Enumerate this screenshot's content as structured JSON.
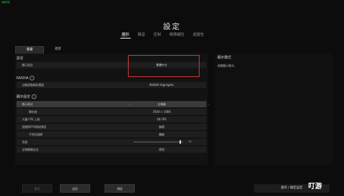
{
  "overlay": {
    "fps": "99FPS"
  },
  "title": "設定",
  "main_tabs": [
    "圖形",
    "聲音",
    "控制",
    "無障礙性",
    "遊戲性"
  ],
  "sub_tabs": [
    "基礎",
    "進階"
  ],
  "sections": {
    "language": "語言",
    "nvidia": "NVIDIA",
    "display": "顯示設定"
  },
  "rows": {
    "display_language": {
      "label": "顯示語言",
      "value": "繁體中文"
    },
    "nvidia_highlights": {
      "label": "自動錄製精彩畫面",
      "value": "NVIDIA Highlights"
    },
    "display_mode": {
      "label": "顯示模式",
      "value": "全螢幕"
    },
    "resolution": {
      "label": "解析度",
      "value": "1920 × 1080"
    },
    "max_fps": {
      "label": "大廳 FPS 上限",
      "value": "60 FPS"
    },
    "fps_limit": {
      "label": "遊戲時FPS限制預設",
      "value": "無限"
    },
    "smoothing": {
      "label": "平滑化調節",
      "value": "開啟"
    },
    "brightness": {
      "label": "亮度",
      "value": "50",
      "level_percent": 95
    },
    "full_screen_optimization": {
      "label": "全螢幕最佳化",
      "value": "停用"
    }
  },
  "right_panel": {
    "title": "顯示模式",
    "description": "遊戲顯示模式。"
  },
  "buttons": {
    "apply": "套用",
    "back": "返回",
    "default": "預設",
    "right_action": "操作 / 鎖定設定"
  },
  "watermark": "叮游"
}
